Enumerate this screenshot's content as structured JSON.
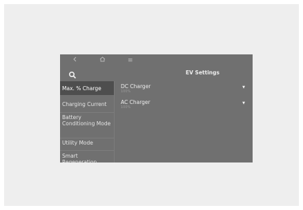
{
  "app": {
    "title": "EV Settings"
  },
  "topbar": {
    "back_icon": "back-icon",
    "home_icon": "home-icon",
    "menu_icon": "menu-icon",
    "menu_symbol": "≡"
  },
  "search": {
    "icon": "search-icon"
  },
  "sidebar": {
    "items": [
      {
        "label": "Max. % Charge",
        "selected": true
      },
      {
        "label": "Charging Current",
        "selected": false
      },
      {
        "label": "Battery Conditioning Mode",
        "selected": false
      },
      {
        "label": "Utility Mode",
        "selected": false
      },
      {
        "label": "Smart Regeneration",
        "selected": false
      }
    ]
  },
  "settings": [
    {
      "label": "DC Charger",
      "value": "100%",
      "caret": "▼"
    },
    {
      "label": "AC Charger",
      "value": "100%",
      "caret": "▼"
    }
  ],
  "colors": {
    "screen_bg": "#707070",
    "selected_bg": "#4e4e4e",
    "frame_bg": "#eeeeee",
    "text": "#e6e6e6"
  }
}
